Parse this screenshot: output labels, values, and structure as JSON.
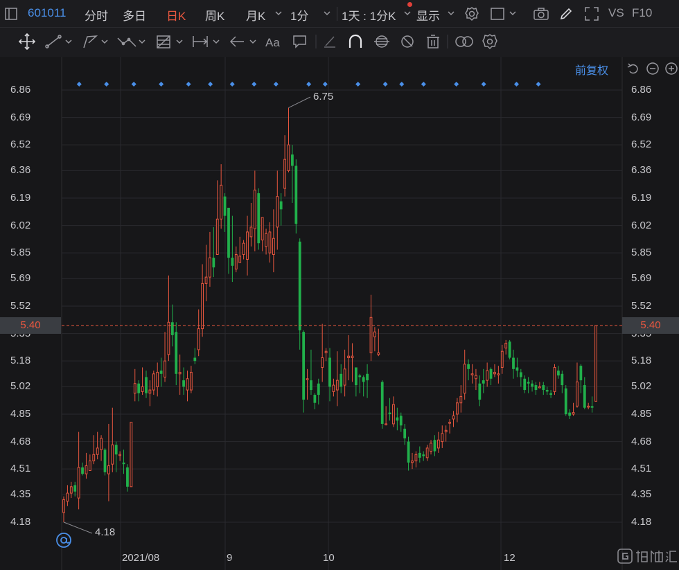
{
  "topbar": {
    "stock_code": "601011",
    "tabs": [
      "分时",
      "多日",
      "日K",
      "周K",
      "月K",
      "1分"
    ],
    "active_tab": "日K",
    "period_label": "1天 : 1分K",
    "display_label": "显示",
    "vs_label": "VS",
    "f10_label": "F10"
  },
  "adjust": {
    "label": "前复权"
  },
  "chart_data": {
    "type": "candlestick",
    "x_labels": [
      "2021/08",
      "9",
      "10",
      "12"
    ],
    "y_ticks": [
      6.86,
      6.69,
      6.52,
      6.36,
      6.19,
      6.02,
      5.85,
      5.69,
      5.52,
      5.35,
      5.18,
      5.02,
      4.85,
      4.68,
      4.51,
      4.35,
      4.18
    ],
    "ylim": [
      4.12,
      6.92
    ],
    "current_price": 5.4,
    "current_price_label": "5.40",
    "high_annotation": "6.75",
    "low_annotation": "4.18",
    "high_value": 6.75,
    "low_value": 4.18,
    "grid": true,
    "candles": [
      [
        4.24,
        4.32,
        4.34,
        4.18
      ],
      [
        4.31,
        4.36,
        4.41,
        4.28
      ],
      [
        4.36,
        4.4,
        4.43,
        4.33
      ],
      [
        4.41,
        4.37,
        4.43,
        4.34
      ],
      [
        4.33,
        4.52,
        4.74,
        4.26
      ],
      [
        4.52,
        4.48,
        4.55,
        4.47
      ],
      [
        4.48,
        4.53,
        4.61,
        4.45
      ],
      [
        4.5,
        4.56,
        4.6,
        4.5
      ],
      [
        4.56,
        4.6,
        4.72,
        4.54
      ],
      [
        4.6,
        4.64,
        4.74,
        4.57
      ],
      [
        4.63,
        4.7,
        4.72,
        4.56
      ],
      [
        4.63,
        4.49,
        4.64,
        4.47
      ],
      [
        4.48,
        4.53,
        4.79,
        4.31
      ],
      [
        4.54,
        4.66,
        4.89,
        4.49
      ],
      [
        4.66,
        4.6,
        4.68,
        4.49
      ],
      [
        4.6,
        4.6,
        4.62,
        4.56
      ],
      [
        4.55,
        4.54,
        4.63,
        4.48
      ],
      [
        4.52,
        4.4,
        4.54,
        4.37
      ],
      [
        4.4,
        4.8,
        4.8,
        4.4
      ],
      [
        4.98,
        5.04,
        5.13,
        4.93
      ],
      [
        5.04,
        4.98,
        5.06,
        4.93
      ],
      [
        4.99,
        5.02,
        5.14,
        4.97
      ],
      [
        5.08,
        4.98,
        5.12,
        4.95
      ],
      [
        4.98,
        5.0,
        5.06,
        4.9
      ],
      [
        5.0,
        5.1,
        5.12,
        4.97
      ],
      [
        5.02,
        5.11,
        5.17,
        4.96
      ],
      [
        5.12,
        5.1,
        5.2,
        5.02
      ],
      [
        5.08,
        5.18,
        5.36,
        5.05
      ],
      [
        5.22,
        5.42,
        5.71,
        5.18
      ],
      [
        5.42,
        5.34,
        5.53,
        5.27
      ],
      [
        5.36,
        5.1,
        5.42,
        5.03
      ],
      [
        5.1,
        5.11,
        5.22,
        4.97
      ],
      [
        5.06,
        5.02,
        5.14,
        4.97
      ],
      [
        5.0,
        5.07,
        5.12,
        4.93
      ],
      [
        5.0,
        5.11,
        5.15,
        4.98
      ],
      [
        5.2,
        5.18,
        5.26,
        5.16
      ],
      [
        5.25,
        5.38,
        5.5,
        5.21
      ],
      [
        5.38,
        5.66,
        5.78,
        5.33
      ],
      [
        5.66,
        5.7,
        5.9,
        5.55
      ],
      [
        5.7,
        5.82,
        5.98,
        5.64
      ],
      [
        5.82,
        5.76,
        6.01,
        5.7
      ],
      [
        5.84,
        6.06,
        6.3,
        5.84
      ],
      [
        6.06,
        6.27,
        6.4,
        6.0
      ],
      [
        6.2,
        6.08,
        6.22,
        5.98
      ],
      [
        6.13,
        5.82,
        6.13,
        5.72
      ],
      [
        5.82,
        5.77,
        6.08,
        5.67
      ],
      [
        5.75,
        5.84,
        5.89,
        5.73
      ],
      [
        5.79,
        5.83,
        5.95,
        5.79
      ],
      [
        5.84,
        5.91,
        5.93,
        5.81
      ],
      [
        5.81,
        5.98,
        6.08,
        5.71
      ],
      [
        5.95,
        6.01,
        6.16,
        5.89
      ],
      [
        6.0,
        6.24,
        6.36,
        5.86
      ],
      [
        6.22,
        5.91,
        6.25,
        5.87
      ],
      [
        5.93,
        6.07,
        6.07,
        5.86
      ],
      [
        5.89,
        5.97,
        6.0,
        5.84
      ],
      [
        5.85,
        5.98,
        6.04,
        5.79
      ],
      [
        5.84,
        5.94,
        6.12,
        5.73
      ],
      [
        6.01,
        6.2,
        6.36,
        5.87
      ],
      [
        6.17,
        6.12,
        6.22,
        6.02
      ],
      [
        6.25,
        6.43,
        6.58,
        6.2
      ],
      [
        6.36,
        6.52,
        6.75,
        6.35
      ],
      [
        6.46,
        6.39,
        6.52,
        6.16
      ],
      [
        6.39,
        6.03,
        6.43,
        5.97
      ],
      [
        5.92,
        5.37,
        5.94,
        5.25
      ],
      [
        5.36,
        4.94,
        5.37,
        4.86
      ],
      [
        5.07,
        5.07,
        5.13,
        4.94
      ],
      [
        5.06,
        5.0,
        5.25,
        4.97
      ],
      [
        4.97,
        4.92,
        4.98,
        4.88
      ],
      [
        5.04,
        4.97,
        5.07,
        4.91
      ],
      [
        5.14,
        5.2,
        5.41,
        5.05
      ],
      [
        5.23,
        5.24,
        5.26,
        5.18
      ],
      [
        5.2,
        5.02,
        5.26,
        4.93
      ],
      [
        4.99,
        5.03,
        5.07,
        4.96
      ],
      [
        5.0,
        5.06,
        5.24,
        4.9
      ],
      [
        5.1,
        5.02,
        5.16,
        4.98
      ],
      [
        5.03,
        5.13,
        5.25,
        4.96
      ],
      [
        5.2,
        5.21,
        5.34,
        5.06
      ],
      [
        5.2,
        5.21,
        5.29,
        5.05
      ],
      [
        5.14,
        5.03,
        5.14,
        4.96
      ],
      [
        5.09,
        5.08,
        5.1,
        4.98
      ],
      [
        5.08,
        5.05,
        5.09,
        4.96
      ],
      [
        5.1,
        5.06,
        5.16,
        4.95
      ],
      [
        5.23,
        5.45,
        5.59,
        5.18
      ],
      [
        5.33,
        5.36,
        5.39,
        5.24
      ],
      [
        5.22,
        5.23,
        5.38,
        5.21
      ],
      [
        5.05,
        4.79,
        5.06,
        4.76
      ],
      [
        4.79,
        4.79,
        4.9,
        4.78
      ],
      [
        4.86,
        4.85,
        4.95,
        4.81
      ],
      [
        4.79,
        4.91,
        4.96,
        4.77
      ],
      [
        4.83,
        4.81,
        4.89,
        4.75
      ],
      [
        4.84,
        4.78,
        4.86,
        4.74
      ],
      [
        4.76,
        4.7,
        4.79,
        4.66
      ],
      [
        4.68,
        4.55,
        4.71,
        4.5
      ],
      [
        4.55,
        4.56,
        4.61,
        4.51
      ],
      [
        4.56,
        4.6,
        4.62,
        4.52
      ],
      [
        4.61,
        4.58,
        4.65,
        4.55
      ],
      [
        4.6,
        4.59,
        4.62,
        4.56
      ],
      [
        4.58,
        4.64,
        4.66,
        4.56
      ],
      [
        4.62,
        4.67,
        4.69,
        4.6
      ],
      [
        4.69,
        4.62,
        4.72,
        4.59
      ],
      [
        4.64,
        4.69,
        4.74,
        4.61
      ],
      [
        4.68,
        4.73,
        4.78,
        4.64
      ],
      [
        4.74,
        4.75,
        4.78,
        4.68
      ],
      [
        4.8,
        4.8,
        4.82,
        4.73
      ],
      [
        4.82,
        4.84,
        4.87,
        4.77
      ],
      [
        4.85,
        4.92,
        4.95,
        4.8
      ],
      [
        4.92,
        4.96,
        5.03,
        4.86
      ],
      [
        4.98,
        5.16,
        5.25,
        4.94
      ],
      [
        5.16,
        5.13,
        5.19,
        5.06
      ],
      [
        5.1,
        5.1,
        5.16,
        5.04
      ],
      [
        5.07,
        5.09,
        5.13,
        5.0
      ],
      [
        5.04,
        4.94,
        5.09,
        4.9
      ],
      [
        5.06,
        5.04,
        5.13,
        4.98
      ],
      [
        5.06,
        5.12,
        5.17,
        5.02
      ],
      [
        5.13,
        5.07,
        5.14,
        5.03
      ],
      [
        5.1,
        5.11,
        5.16,
        5.08
      ],
      [
        5.1,
        5.1,
        5.15,
        5.04
      ],
      [
        5.14,
        5.24,
        5.28,
        5.1
      ],
      [
        5.26,
        5.29,
        5.31,
        5.22
      ],
      [
        5.3,
        5.2,
        5.31,
        5.19
      ],
      [
        5.2,
        5.13,
        5.25,
        5.07
      ],
      [
        5.14,
        5.12,
        5.2,
        5.08
      ],
      [
        5.11,
        5.08,
        5.13,
        5.02
      ],
      [
        5.07,
        5.0,
        5.09,
        4.98
      ],
      [
        5.05,
        5.04,
        5.08,
        4.98
      ],
      [
        5.04,
        5.02,
        5.06,
        4.99
      ],
      [
        5.03,
        5.0,
        5.05,
        4.97
      ],
      [
        5.02,
        5.02,
        5.05,
        5.01
      ],
      [
        5.03,
        5.0,
        5.05,
        4.97
      ],
      [
        5.0,
        4.99,
        5.02,
        4.97
      ],
      [
        4.98,
        4.97,
        5.0,
        4.95
      ],
      [
        4.99,
        5.14,
        5.16,
        4.97
      ],
      [
        5.12,
        5.09,
        5.15,
        5.07
      ],
      [
        5.1,
        5.03,
        5.12,
        4.98
      ],
      [
        5.01,
        4.85,
        5.03,
        4.84
      ],
      [
        4.86,
        4.84,
        4.88,
        4.82
      ],
      [
        4.85,
        4.86,
        4.92,
        4.84
      ],
      [
        4.9,
        5.05,
        5.17,
        4.89
      ],
      [
        5.15,
        5.06,
        5.16,
        4.98
      ],
      [
        5.03,
        4.89,
        5.08,
        4.88
      ],
      [
        4.9,
        4.9,
        4.92,
        4.88
      ],
      [
        4.9,
        4.89,
        4.96,
        4.86
      ],
      [
        4.93,
        5.4,
        5.4,
        4.93
      ]
    ],
    "markers": [
      0.02,
      0.07,
      0.12,
      0.17,
      0.22,
      0.26,
      0.3,
      0.34,
      0.38,
      0.44,
      0.47,
      0.53,
      0.58,
      0.61,
      0.65,
      0.71,
      0.76,
      0.82,
      0.86
    ]
  }
}
